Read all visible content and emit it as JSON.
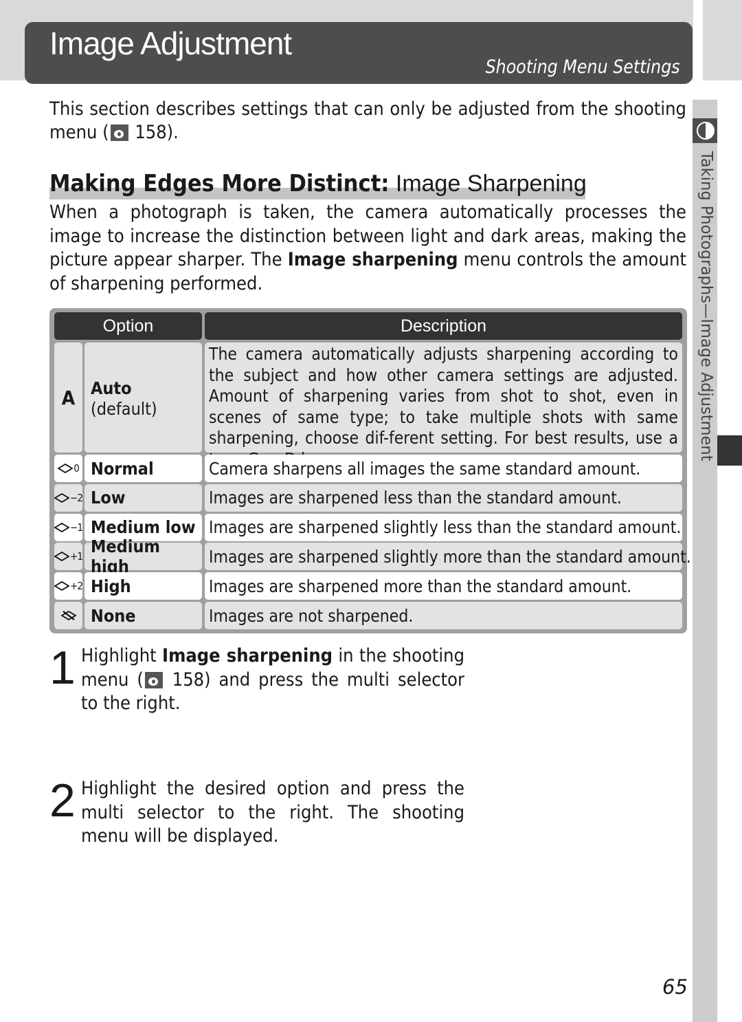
{
  "header": {
    "title": "Image Adjustment",
    "subtitle": "Shooting Menu Settings"
  },
  "side_tab": {
    "icon": "half-circle-icon",
    "label": "Taking Photographs—Image Adjustment"
  },
  "intro": {
    "text_before": "This section describes settings that can only be adjusted from the shooting menu (",
    "icon": "shooting-menu-icon",
    "page_ref": " 158)."
  },
  "section": {
    "heading_bold": "Making Edges More Distinct:",
    "heading_light": " Image Sharpening",
    "para_part1": "When a photograph is taken, the camera automatically processes the image to increase the distinction between light and dark areas, making the picture appear sharper.  The ",
    "para_bold": "Image sharpening",
    "para_part2": " menu controls the amount of sharpening performed."
  },
  "table": {
    "headers": [
      "Option",
      "Description"
    ],
    "auto_row": {
      "icon_glyph": "A",
      "name": "Auto",
      "note": "(default)",
      "description": "The camera automatically adjusts sharpening according to the subject and how other camera settings are adjusted.  Amount of sharpening varies from shot to shot, even in scenes of same type; to take multiple shots with same sharpening, choose dif-ferent setting.  For best results, use a type G or D lens."
    },
    "rows": [
      {
        "icon": "sharpening-normal-icon",
        "level": "0",
        "name": "Normal",
        "description": "Camera sharpens all images the same standard amount."
      },
      {
        "icon": "sharpening-low-icon",
        "level": "−2",
        "name": "Low",
        "description": "Images are sharpened less than the standard amount."
      },
      {
        "icon": "sharpening-medium-low-icon",
        "level": "−1",
        "name": "Medium low",
        "description": "Images are sharpened slightly less than the standard amount."
      },
      {
        "icon": "sharpening-medium-high-icon",
        "level": "+1",
        "name": "Medium high",
        "description": "Images are sharpened slightly more than the standard amount."
      },
      {
        "icon": "sharpening-high-icon",
        "level": "+2",
        "name": "High",
        "description": "Images are sharpened more than the standard amount."
      },
      {
        "icon": "sharpening-none-icon",
        "level": "",
        "name": "None",
        "description": "Images are not sharpened."
      }
    ]
  },
  "steps": [
    {
      "number": "1",
      "text_before": "Highlight ",
      "bold": "Image sharpening",
      "text_middle": " in the shooting menu (",
      "page_ref": " 158) and press the multi selector to the right."
    },
    {
      "number": "2",
      "text": "Highlight the desired option and press the multi selector to the right.  The shooting menu will be displayed."
    }
  ],
  "page_number": "65",
  "colors": {
    "title_bar": "#4d4d4d",
    "table_header": "#333333",
    "table_frame": "#a0a0a0",
    "row_grey": "#e3e3e3",
    "side_tab": "#cccccc"
  }
}
